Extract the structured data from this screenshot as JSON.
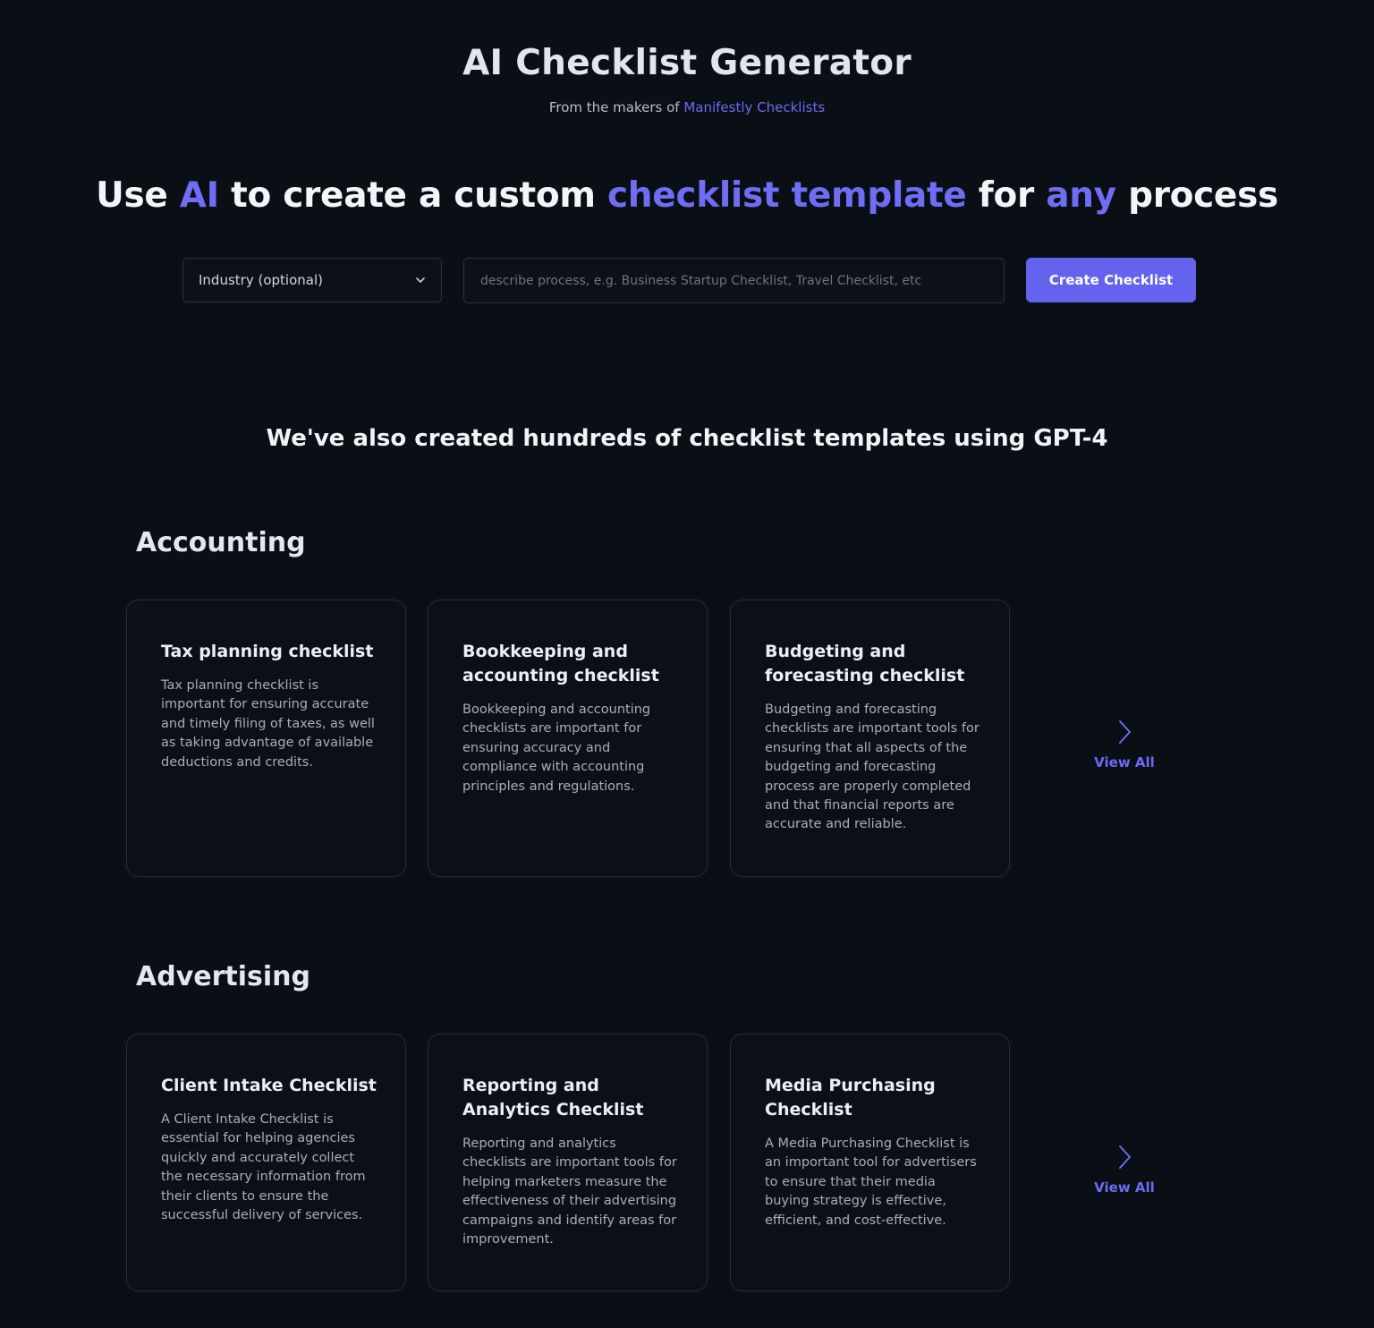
{
  "header": {
    "title": "AI Checklist Generator",
    "makers_prefix": "From the makers of ",
    "makers_link": "Manifestly Checklists"
  },
  "hero": {
    "part1": "Use ",
    "hl1": "AI",
    "part2": " to create a custom ",
    "hl2": "checklist template",
    "part3": " for ",
    "hl3": "any",
    "part4": " process"
  },
  "form": {
    "industry_label": "Industry (optional)",
    "process_placeholder": "describe process, e.g. Business Startup Checklist, Travel Checklist, etc",
    "process_value": "",
    "create_label": "Create Checklist"
  },
  "templates_heading": "We've also created hundreds of checklist templates using GPT-4",
  "sections": [
    {
      "title": "Accounting",
      "view_all": "View All",
      "cards": [
        {
          "title": "Tax planning checklist",
          "desc": "Tax planning checklist is important for ensuring accurate and timely filing of taxes, as well as taking advantage of available deductions and credits."
        },
        {
          "title": "Bookkeeping and accounting checklist",
          "desc": "Bookkeeping and accounting checklists are important for ensuring accuracy and compliance with accounting principles and regulations."
        },
        {
          "title": "Budgeting and forecasting checklist",
          "desc": "Budgeting and forecasting checklists are important tools for ensuring that all aspects of the budgeting and forecasting process are properly completed and that financial reports are accurate and reliable."
        }
      ]
    },
    {
      "title": "Advertising",
      "view_all": "View All",
      "cards": [
        {
          "title": "Client Intake Checklist",
          "desc": "A Client Intake Checklist is essential for helping agencies quickly and accurately collect the necessary information from their clients to ensure the successful delivery of services."
        },
        {
          "title": "Reporting and Analytics Checklist",
          "desc": "Reporting and analytics checklists are important tools for helping marketers measure the effectiveness of their advertising campaigns and identify areas for improvement."
        },
        {
          "title": "Media Purchasing Checklist",
          "desc": "A Media Purchasing Checklist is an important tool for advertisers to ensure that their media buying strategy is effective, efficient, and cost-effective."
        }
      ]
    }
  ],
  "colors": {
    "background": "#0a0e15",
    "accent": "#6363ee",
    "highlight_text": "#6e6df3",
    "card_border": "#262c36"
  },
  "icons": {
    "select_chevron": "chevron-down-icon",
    "view_all": "chevron-right-icon"
  }
}
